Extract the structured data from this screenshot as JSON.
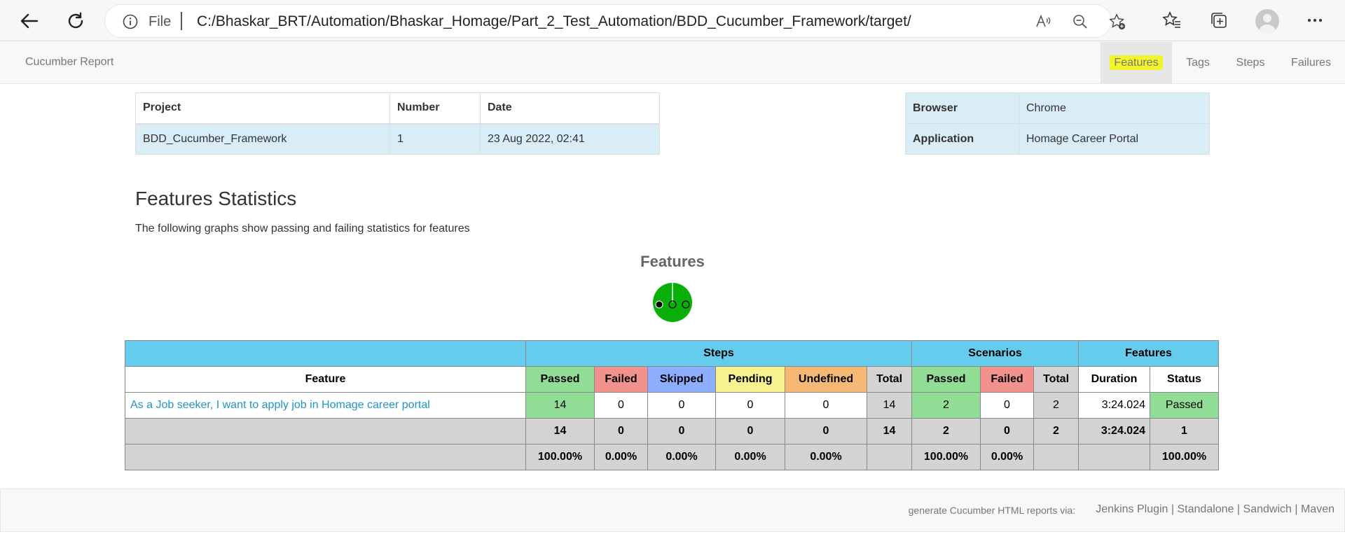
{
  "browser": {
    "file_label": "File",
    "url": "C:/Bhaskar_BRT/Automation/Bhaskar_Homage/Part_2_Test_Automation/BDD_Cucumber_Framework/target/cucumber-html-re...",
    "icons": [
      "back-icon",
      "refresh-icon",
      "info-icon",
      "read-aloud-icon",
      "zoom-out-icon",
      "add-favorite-icon",
      "favorites-icon",
      "collections-icon",
      "profile-avatar",
      "more-icon"
    ]
  },
  "navbar": {
    "brand": "Cucumber Report",
    "items": [
      "Features",
      "Tags",
      "Steps",
      "Failures"
    ],
    "active": "Features",
    "highlight_color": "#f2f52a"
  },
  "project_table": {
    "headers": [
      "Project",
      "Number",
      "Date"
    ],
    "row": [
      "BDD_Cucumber_Framework",
      "1",
      "23 Aug 2022, 02:41"
    ]
  },
  "env_table": [
    {
      "key": "Browser",
      "value": "Chrome"
    },
    {
      "key": "Application",
      "value": "Homage Career Portal"
    }
  ],
  "stats": {
    "title": "Features Statistics",
    "subtitle": "The following graphs show passing and failing statistics for features",
    "chart_title": "Features",
    "pie_color": "#0aaf0a"
  },
  "table": {
    "groups": [
      "Steps",
      "Scenarios",
      "Features"
    ],
    "headers": [
      "Feature",
      "Passed",
      "Failed",
      "Skipped",
      "Pending",
      "Undefined",
      "Total",
      "Passed",
      "Failed",
      "Total",
      "Duration",
      "Status"
    ],
    "rows": [
      [
        "As a Job seeker, I want to apply job in Homage career portal",
        "14",
        "0",
        "0",
        "0",
        "0",
        "14",
        "2",
        "0",
        "2",
        "3:24.024",
        "Passed"
      ]
    ],
    "totals": [
      "",
      "14",
      "0",
      "0",
      "0",
      "0",
      "14",
      "2",
      "0",
      "2",
      "3:24.024",
      "1"
    ],
    "percentages": [
      "",
      "100.00%",
      "0.00%",
      "0.00%",
      "0.00%",
      "0.00%",
      "",
      "100.00%",
      "0.00%",
      "",
      "",
      "100.00%"
    ]
  },
  "footer": {
    "generate_text": "generate Cucumber HTML reports via:",
    "links": [
      "Jenkins Plugin",
      "Standalone",
      "Sandwich",
      "Maven"
    ],
    "separator": "|"
  }
}
